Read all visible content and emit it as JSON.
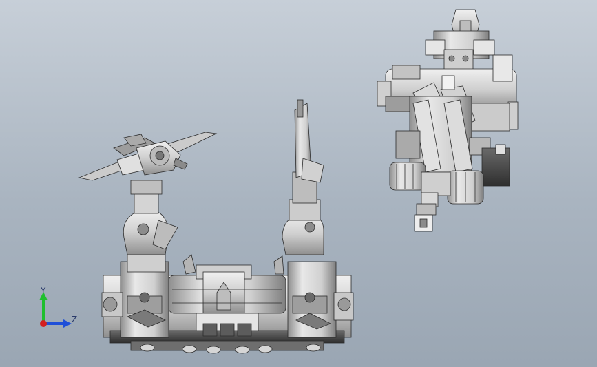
{
  "viewport": {
    "background_top": "#c7cfd8",
    "background_bottom": "#9aa6b3"
  },
  "triad": {
    "y_label": "Y",
    "z_label": "Z",
    "y_color": "#1fbf2e",
    "z_color": "#1f4fd8",
    "x_color": "#d41f1f"
  },
  "model": {
    "part_fill": "#d9d9d9",
    "part_shade": "#9c9c9c",
    "edge_color": "#2b2b2b",
    "icon": "3d-cad-assembly"
  }
}
